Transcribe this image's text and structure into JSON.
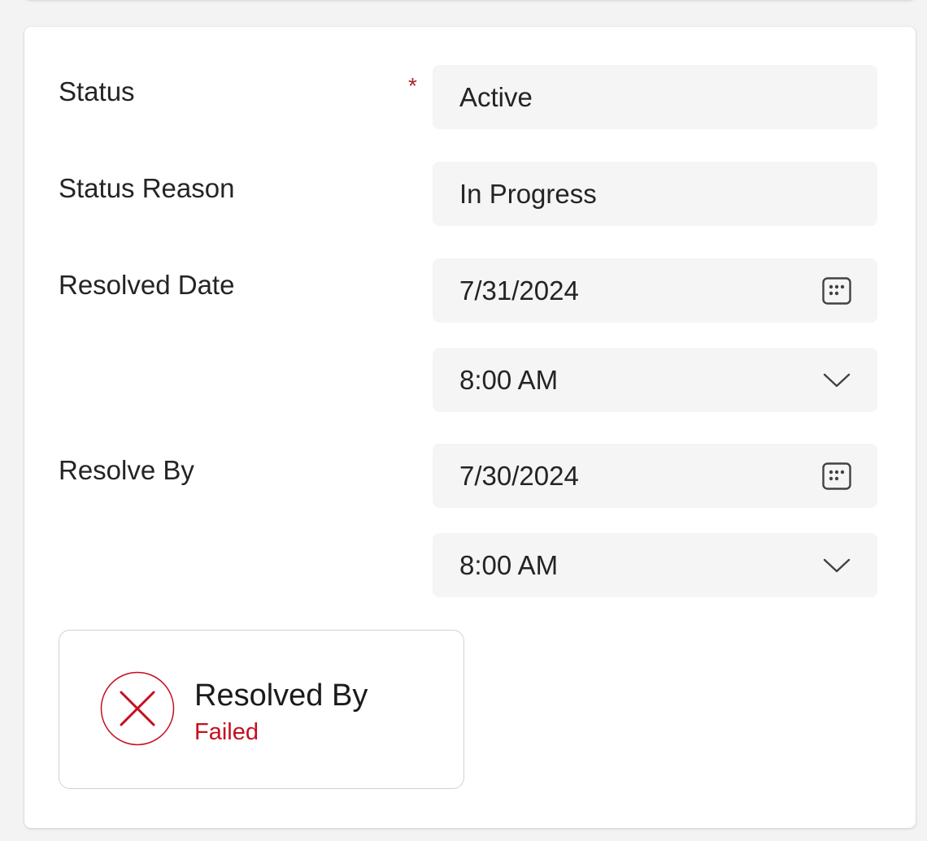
{
  "form": {
    "fields": [
      {
        "label": "Status",
        "value": "Active",
        "required": true
      },
      {
        "label": "Status Reason",
        "value": "In Progress"
      },
      {
        "label": "Resolved Date",
        "date": "7/31/2024",
        "time": "8:00 AM"
      },
      {
        "label": "Resolve By",
        "date": "7/30/2024",
        "time": "8:00 AM"
      }
    ],
    "required_marker": "*"
  },
  "outcome": {
    "title": "Resolved By",
    "status": "Failed",
    "icon": "close-circle-icon",
    "status_color": "#c50f1f"
  }
}
